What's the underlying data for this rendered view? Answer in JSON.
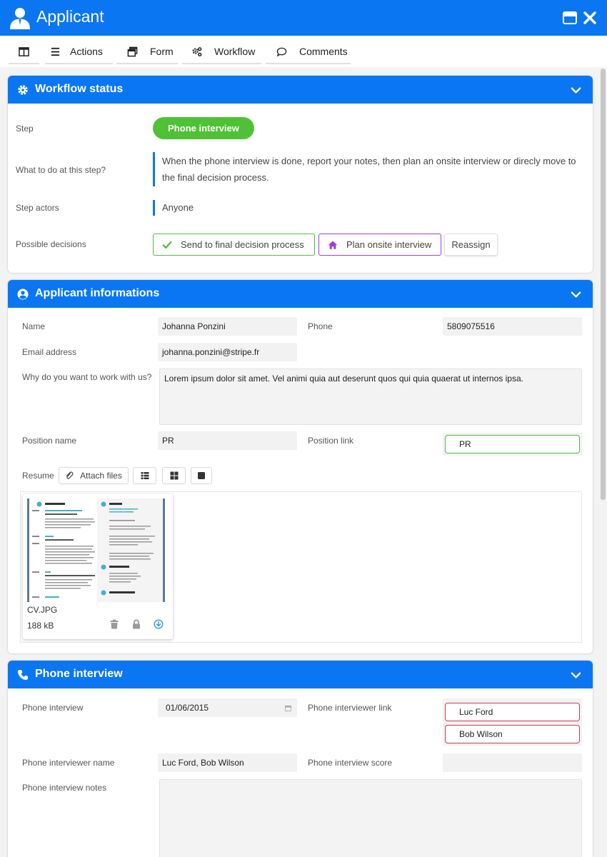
{
  "window": {
    "title": "Applicant"
  },
  "toolbar": {
    "actions_label": "Actions",
    "form_label": "Form",
    "workflow_label": "Workflow",
    "comments_label": "Comments"
  },
  "workflow": {
    "header": "Workflow status",
    "step_label": "Step",
    "step_value": "Phone interview",
    "todo_label": "What to do at this step?",
    "todo_text": "When the phone interview is done, report your notes, then plan an onsite interview or direcly move to the final decision process.",
    "actors_label": "Step actors",
    "actors_value": "Anyone",
    "decisions_label": "Possible decisions",
    "decision_final": "Send to final decision process",
    "decision_onsite": "Plan onsite interview",
    "decision_reassign": "Reassign"
  },
  "applicant": {
    "header": "Applicant informations",
    "name_label": "Name",
    "name_value": "Johanna Ponzini",
    "phone_label": "Phone",
    "phone_value": "5809075516",
    "email_label": "Email address",
    "email_value": "johanna.ponzini@stripe.fr",
    "why_label": "Why do you want to work with us?",
    "why_value": "Lorem ipsum dolor sit amet. Vel animi quia aut deserunt quos qui quia quaerat ut internos ipsa.",
    "position_name_label": "Position name",
    "position_name_value": "PR",
    "position_link_label": "Position link",
    "position_link_value": "PR",
    "resume_label": "Resume",
    "attach_label": "Attach files",
    "file": {
      "name": "CV.JPG",
      "size": "188 kB"
    }
  },
  "phone": {
    "header": "Phone interview",
    "date_label": "Phone interview",
    "date_value": "01/06/2015",
    "interviewer_link_label": "Phone interviewer link",
    "interviewers": [
      "Luc Ford",
      "Bob Wilson"
    ],
    "interviewer_name_label": "Phone interviewer name",
    "interviewer_name_value": "Luc Ford, Bob Wilson",
    "score_label": "Phone interview score",
    "score_value": "",
    "notes_label": "Phone interview notes"
  },
  "colors": {
    "brand": "#0b76f2",
    "step_green": "#4fc136",
    "decision_green": "#4fc136",
    "decision_purple": "#9b3fd6",
    "link_red": "#d23a55"
  },
  "icons": {
    "app": "user-icon",
    "maximize": "maximize-icon",
    "close": "close-icon",
    "workflow": "gear-icon",
    "applicant": "user-circle-icon",
    "phone": "phone-icon"
  }
}
